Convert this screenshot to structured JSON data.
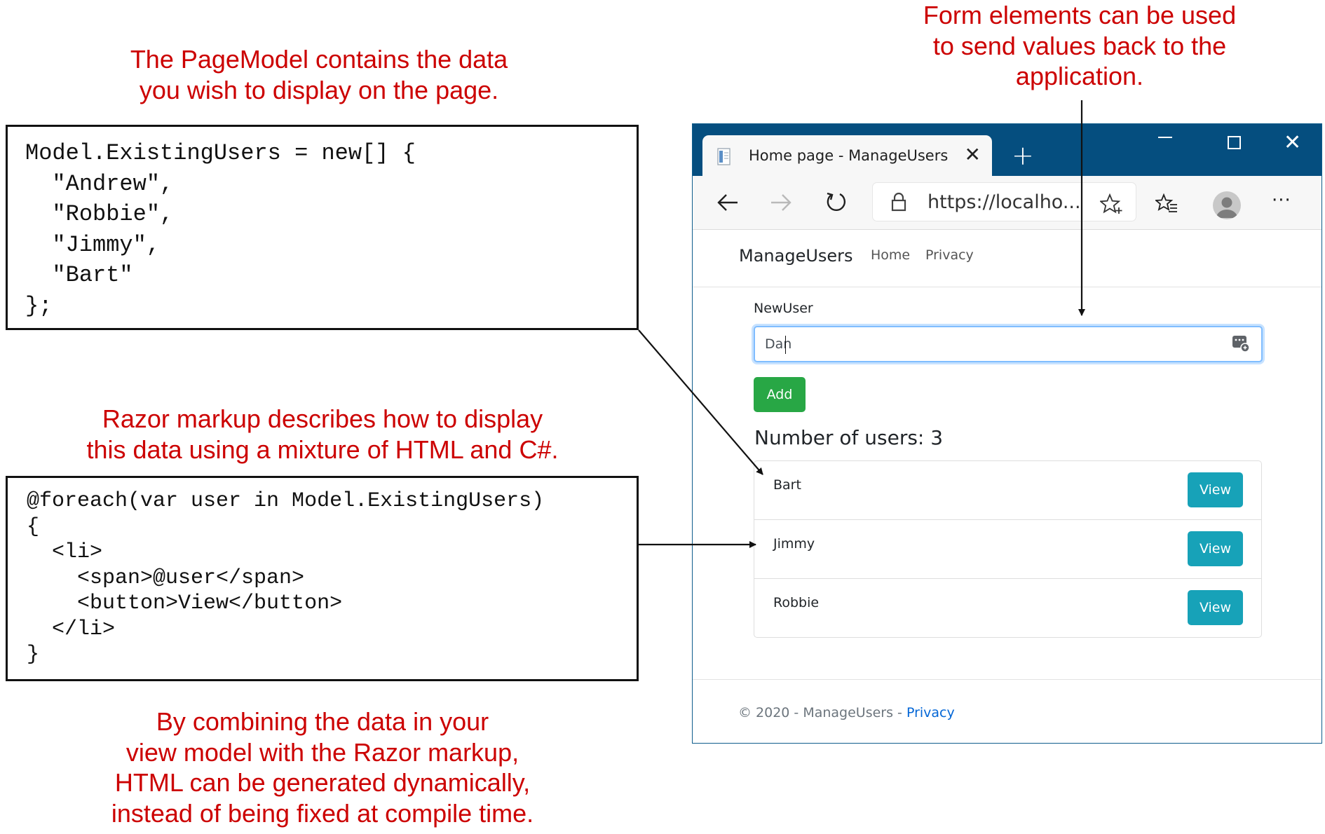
{
  "annotations": {
    "page_model": [
      "The PageModel contains the data",
      "you wish to display on the page."
    ],
    "form_elements": [
      "Form elements can be used",
      "to send values back to the",
      "application."
    ],
    "razor_markup": [
      "Razor markup describes how to display",
      "this data using a mixture of HTML and C#."
    ],
    "combining": [
      "By combining the data in your",
      "view model with the Razor markup,",
      "HTML can be generated dynamically,",
      "instead of being fixed at compile time."
    ]
  },
  "code": {
    "page_model": "Model.ExistingUsers = new[] {\n  \"Andrew\",\n  \"Robbie\",\n  \"Jimmy\",\n  \"Bart\"\n};",
    "razor": "@foreach(var user in Model.ExistingUsers)\n{\n  <li>\n    <span>@user</span>\n    <button>View</button>\n  </li>\n}"
  },
  "browser": {
    "tab_title": "Home page - ManageUsers",
    "tab_close": "✕",
    "new_tab": "+",
    "close": "✕",
    "url": "https://localho...",
    "more": "···",
    "icons": {
      "back": "arrow-left-icon",
      "forward": "arrow-right-icon",
      "refresh": "refresh-icon",
      "lock": "lock-icon",
      "favorite": "star-add-icon",
      "favorites": "favorites-list-icon",
      "profile": "profile-avatar-icon"
    }
  },
  "app": {
    "brand": "ManageUsers",
    "nav": [
      "Home",
      "Privacy"
    ],
    "form_label": "NewUser",
    "input_value": "Dan",
    "add_label": "Add",
    "count_heading": "Number of users: 3",
    "users": [
      {
        "name": "Bart",
        "button": "View"
      },
      {
        "name": "Jimmy",
        "button": "View"
      },
      {
        "name": "Robbie",
        "button": "View"
      }
    ],
    "footer_text": "© 2020 - ManageUsers - ",
    "footer_link": "Privacy"
  },
  "colors": {
    "annotation": "#cc0000",
    "titlebar": "#054e7f",
    "add_button": "#28a745",
    "view_button": "#17a2b8",
    "link": "#0366d6"
  }
}
